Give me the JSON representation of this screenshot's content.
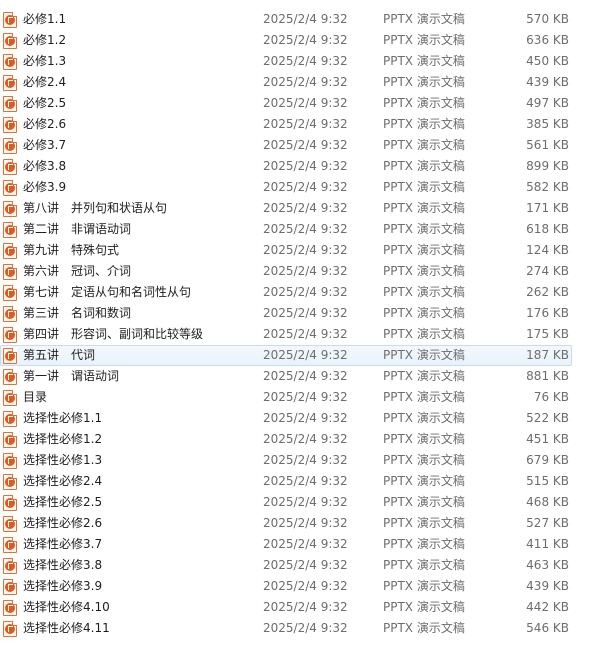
{
  "file_list": {
    "rows": [
      {
        "name": "必修1.1",
        "date": "2025/2/4 9:32",
        "type": "PPTX 演示文稿",
        "size": "570 KB"
      },
      {
        "name": "必修1.2",
        "date": "2025/2/4 9:32",
        "type": "PPTX 演示文稿",
        "size": "636 KB"
      },
      {
        "name": "必修1.3",
        "date": "2025/2/4 9:32",
        "type": "PPTX 演示文稿",
        "size": "450 KB"
      },
      {
        "name": "必修2.4",
        "date": "2025/2/4 9:32",
        "type": "PPTX 演示文稿",
        "size": "439 KB"
      },
      {
        "name": "必修2.5",
        "date": "2025/2/4 9:32",
        "type": "PPTX 演示文稿",
        "size": "497 KB"
      },
      {
        "name": "必修2.6",
        "date": "2025/2/4 9:32",
        "type": "PPTX 演示文稿",
        "size": "385 KB"
      },
      {
        "name": "必修3.7",
        "date": "2025/2/4 9:32",
        "type": "PPTX 演示文稿",
        "size": "561 KB"
      },
      {
        "name": "必修3.8",
        "date": "2025/2/4 9:32",
        "type": "PPTX 演示文稿",
        "size": "899 KB"
      },
      {
        "name": "必修3.9",
        "date": "2025/2/4 9:32",
        "type": "PPTX 演示文稿",
        "size": "582 KB"
      },
      {
        "name": "第八讲　并列句和状语从句",
        "date": "2025/2/4 9:32",
        "type": "PPTX 演示文稿",
        "size": "171 KB"
      },
      {
        "name": "第二讲　非谓语动词",
        "date": "2025/2/4 9:32",
        "type": "PPTX 演示文稿",
        "size": "618 KB"
      },
      {
        "name": "第九讲　特殊句式",
        "date": "2025/2/4 9:32",
        "type": "PPTX 演示文稿",
        "size": "124 KB"
      },
      {
        "name": "第六讲　冠词、介词",
        "date": "2025/2/4 9:32",
        "type": "PPTX 演示文稿",
        "size": "274 KB"
      },
      {
        "name": "第七讲　定语从句和名词性从句",
        "date": "2025/2/4 9:32",
        "type": "PPTX 演示文稿",
        "size": "262 KB"
      },
      {
        "name": "第三讲　名词和数词",
        "date": "2025/2/4 9:32",
        "type": "PPTX 演示文稿",
        "size": "176 KB"
      },
      {
        "name": "第四讲　形容词、副词和比较等级",
        "date": "2025/2/4 9:32",
        "type": "PPTX 演示文稿",
        "size": "175 KB"
      },
      {
        "name": "第五讲　代词",
        "date": "2025/2/4 9:32",
        "type": "PPTX 演示文稿",
        "size": "187 KB"
      },
      {
        "name": "第一讲　谓语动词",
        "date": "2025/2/4 9:32",
        "type": "PPTX 演示文稿",
        "size": "881 KB"
      },
      {
        "name": "目录",
        "date": "2025/2/4 9:32",
        "type": "PPTX 演示文稿",
        "size": "76 KB"
      },
      {
        "name": "选择性必修1.1",
        "date": "2025/2/4 9:32",
        "type": "PPTX 演示文稿",
        "size": "522 KB"
      },
      {
        "name": "选择性必修1.2",
        "date": "2025/2/4 9:32",
        "type": "PPTX 演示文稿",
        "size": "451 KB"
      },
      {
        "name": "选择性必修1.3",
        "date": "2025/2/4 9:32",
        "type": "PPTX 演示文稿",
        "size": "679 KB"
      },
      {
        "name": "选择性必修2.4",
        "date": "2025/2/4 9:32",
        "type": "PPTX 演示文稿",
        "size": "515 KB"
      },
      {
        "name": "选择性必修2.5",
        "date": "2025/2/4 9:32",
        "type": "PPTX 演示文稿",
        "size": "468 KB"
      },
      {
        "name": "选择性必修2.6",
        "date": "2025/2/4 9:32",
        "type": "PPTX 演示文稿",
        "size": "527 KB"
      },
      {
        "name": "选择性必修3.7",
        "date": "2025/2/4 9:32",
        "type": "PPTX 演示文稿",
        "size": "411 KB"
      },
      {
        "name": "选择性必修3.8",
        "date": "2025/2/4 9:32",
        "type": "PPTX 演示文稿",
        "size": "463 KB"
      },
      {
        "name": "选择性必修3.9",
        "date": "2025/2/4 9:32",
        "type": "PPTX 演示文稿",
        "size": "439 KB"
      },
      {
        "name": "选择性必修4.10",
        "date": "2025/2/4 9:32",
        "type": "PPTX 演示文稿",
        "size": "442 KB"
      },
      {
        "name": "选择性必修4.11",
        "date": "2025/2/4 9:32",
        "type": "PPTX 演示文稿",
        "size": "546 KB"
      }
    ],
    "hovered_index": 16,
    "icon": "pptx-file-icon",
    "colors": {
      "hover_fill": "#e9f2fb",
      "hover_border": "#c7dcf2",
      "icon_accent": "#e3581d",
      "secondary_text": "#6d6d6d"
    }
  }
}
